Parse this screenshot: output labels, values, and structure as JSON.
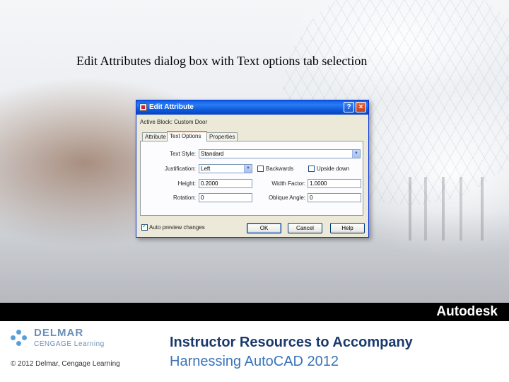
{
  "slide": {
    "title": "Edit Attributes dialog box with Text options tab selection"
  },
  "dialog": {
    "title": "Edit Attribute",
    "active_block": "Active Block: Custom Door",
    "help_button": "?",
    "close_button": "×",
    "tabs": [
      {
        "label": "Attribute",
        "selected": false
      },
      {
        "label": "Text Options",
        "selected": true
      },
      {
        "label": "Properties",
        "selected": false
      }
    ],
    "text_options": {
      "text_style_label": "Text Style:",
      "text_style_value": "Standard",
      "justification_label": "Justification:",
      "justification_value": "Left",
      "backwards_label": "Backwards",
      "backwards_checked": false,
      "upside_down_label": "Upside down",
      "upside_down_checked": false,
      "height_label": "Height:",
      "height_value": "0.2000",
      "width_factor_label": "Width Factor:",
      "width_factor_value": "1.0000",
      "rotation_label": "Rotation:",
      "rotation_value": "0",
      "oblique_angle_label": "Oblique Angle:",
      "oblique_angle_value": "0"
    },
    "auto_preview_label": "Auto preview changes",
    "auto_preview_checked": true,
    "buttons": {
      "ok": "OK",
      "cancel": "Cancel",
      "help": "Help"
    }
  },
  "footer": {
    "autodesk": "Autodesk",
    "publisher": "DELMAR",
    "publisher_sub": "CENGAGE Learning",
    "copyright": "© 2012 Delmar, Cengage Learning",
    "title": "Instructor Resources to Accompany",
    "subtitle": "Harnessing AutoCAD 2012"
  }
}
